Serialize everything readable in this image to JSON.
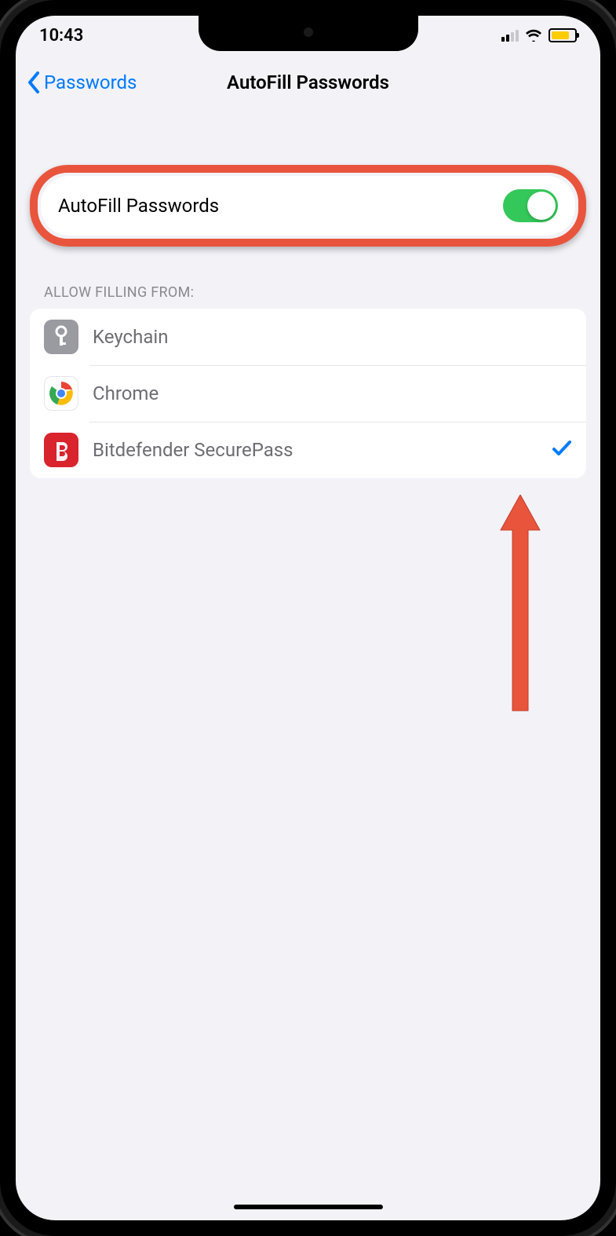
{
  "status": {
    "time": "10:43"
  },
  "nav": {
    "back_label": "Passwords",
    "title": "AutoFill Passwords"
  },
  "autofill": {
    "label": "AutoFill Passwords",
    "enabled": true
  },
  "section_header": "ALLOW FILLING FROM:",
  "providers": [
    {
      "label": "Keychain",
      "selected": false
    },
    {
      "label": "Chrome",
      "selected": false
    },
    {
      "label": "Bitdefender SecurePass",
      "selected": true
    }
  ],
  "colors": {
    "accent": "#007aff",
    "toggle_on": "#34c759",
    "callout": "#e8553c",
    "battery": "#ffcc00",
    "bitdefender": "#d9232d"
  }
}
